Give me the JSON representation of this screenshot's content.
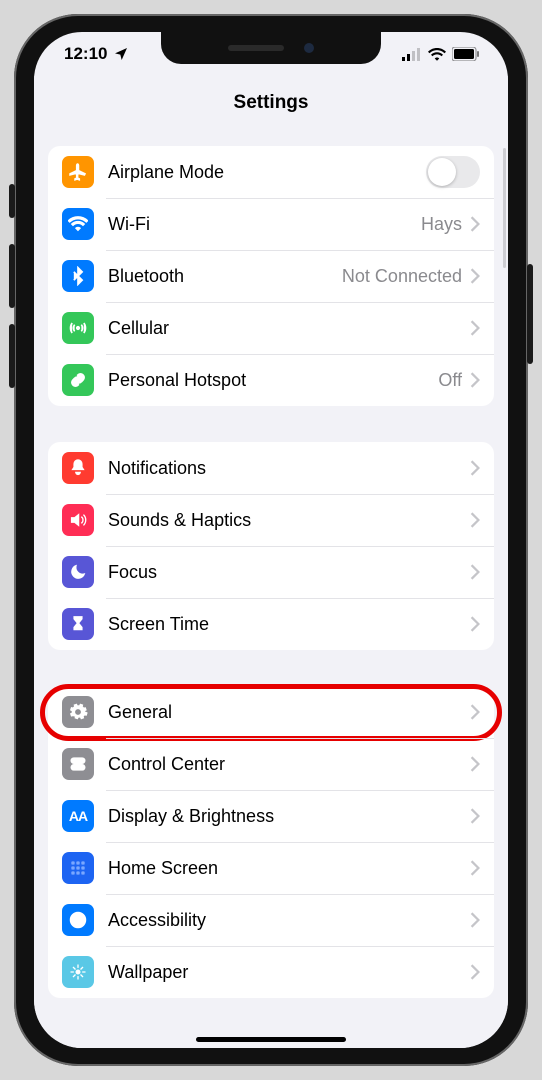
{
  "status_bar": {
    "time": "12:10",
    "indicators": [
      "location-arrow-icon",
      "cell-signal-icon",
      "wifi-icon",
      "battery-icon"
    ]
  },
  "nav_title": "Settings",
  "groups": [
    {
      "id": "connectivity",
      "rows": [
        {
          "id": "airplane",
          "icon": "airplane-icon",
          "icon_bg": "ic-orange",
          "label": "Airplane Mode",
          "control": "toggle",
          "toggle_on": false
        },
        {
          "id": "wifi",
          "icon": "wifi-menu-icon",
          "icon_bg": "ic-blue",
          "label": "Wi-Fi",
          "value": "Hays",
          "control": "disclosure"
        },
        {
          "id": "bluetooth",
          "icon": "bluetooth-icon",
          "icon_bg": "ic-blue",
          "label": "Bluetooth",
          "value": "Not Connected",
          "control": "disclosure"
        },
        {
          "id": "cellular",
          "icon": "antenna-icon",
          "icon_bg": "ic-green",
          "label": "Cellular",
          "control": "disclosure"
        },
        {
          "id": "hotspot",
          "icon": "link-icon",
          "icon_bg": "ic-green",
          "label": "Personal Hotspot",
          "value": "Off",
          "control": "disclosure"
        }
      ]
    },
    {
      "id": "notifications",
      "rows": [
        {
          "id": "notifications",
          "icon": "bell-icon",
          "icon_bg": "ic-red",
          "label": "Notifications",
          "control": "disclosure"
        },
        {
          "id": "sounds",
          "icon": "speaker-icon",
          "icon_bg": "ic-pink",
          "label": "Sounds & Haptics",
          "control": "disclosure"
        },
        {
          "id": "focus",
          "icon": "moon-icon",
          "icon_bg": "ic-indigo",
          "label": "Focus",
          "control": "disclosure"
        },
        {
          "id": "screentime",
          "icon": "hourglass-icon",
          "icon_bg": "ic-indigo",
          "label": "Screen Time",
          "control": "disclosure"
        }
      ]
    },
    {
      "id": "general",
      "rows": [
        {
          "id": "general",
          "icon": "gear-icon",
          "icon_bg": "ic-gray",
          "label": "General",
          "control": "disclosure",
          "highlighted": true
        },
        {
          "id": "controlcenter",
          "icon": "switches-icon",
          "icon_bg": "ic-gray",
          "label": "Control Center",
          "control": "disclosure"
        },
        {
          "id": "display",
          "icon": "aa-icon",
          "icon_bg": "ic-blue",
          "label": "Display & Brightness",
          "control": "disclosure"
        },
        {
          "id": "homescreen",
          "icon": "grid-icon",
          "icon_bg": "ic-darkblue",
          "label": "Home Screen",
          "control": "disclosure"
        },
        {
          "id": "accessibility",
          "icon": "person-icon",
          "icon_bg": "ic-blue",
          "label": "Accessibility",
          "control": "disclosure"
        },
        {
          "id": "wallpaper",
          "icon": "flower-icon",
          "icon_bg": "ic-teal",
          "label": "Wallpaper",
          "control": "disclosure"
        }
      ]
    }
  ]
}
